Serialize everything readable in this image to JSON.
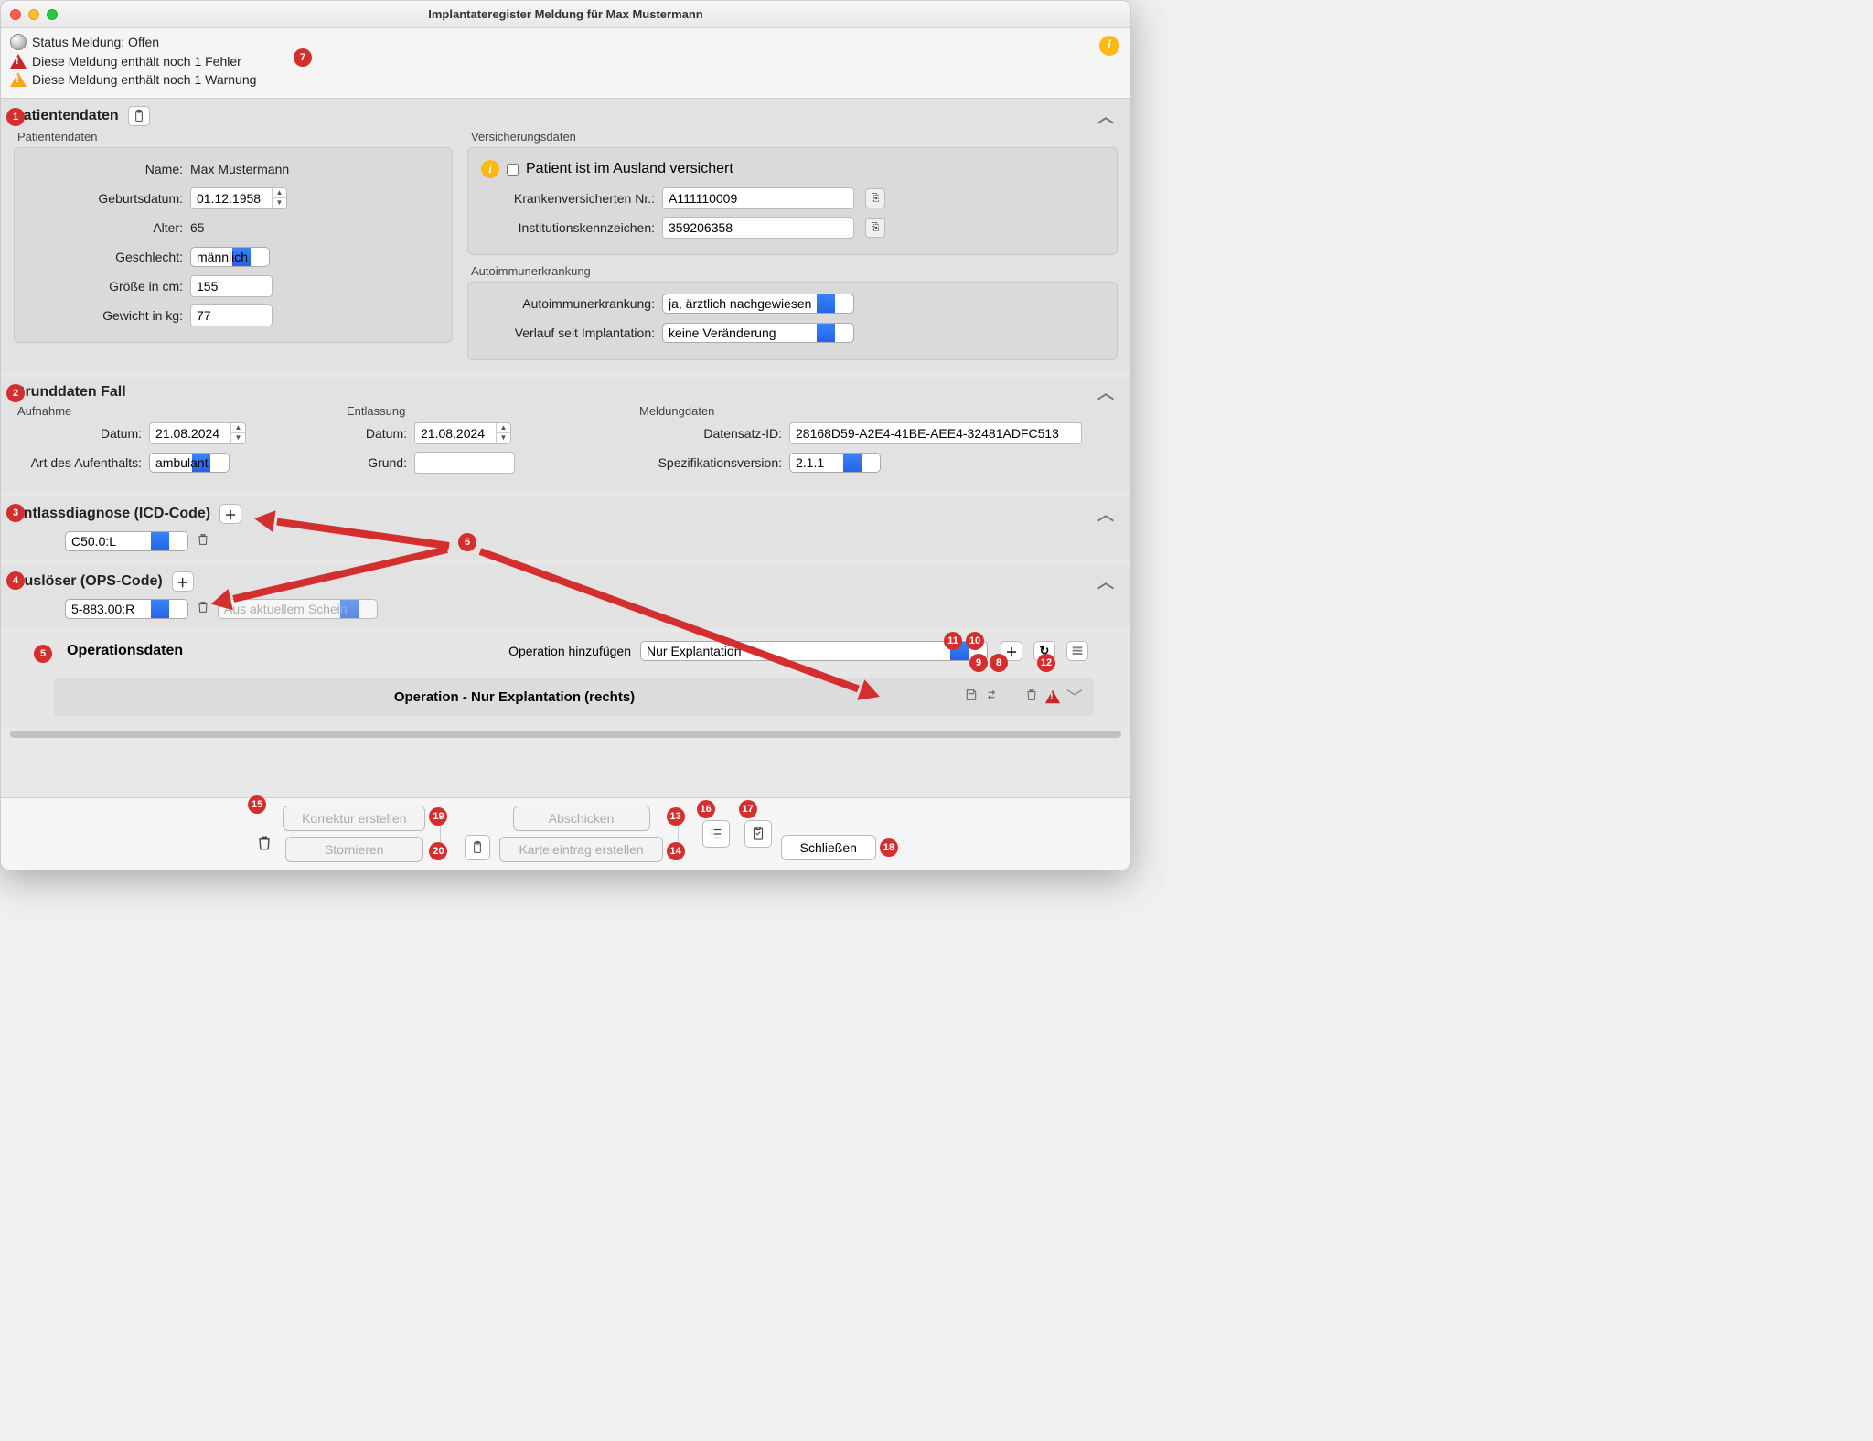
{
  "window_title": "Implantateregister Meldung für Max Mustermann",
  "status": {
    "label": "Status Meldung: Offen",
    "error": "Diese Meldung enthält noch 1 Fehler",
    "warn": "Diese Meldung enthält noch 1 Warnung"
  },
  "sec1": {
    "title": "Patientendaten",
    "left_title": "Patientendaten",
    "name_lbl": "Name:",
    "name": "Max Mustermann",
    "dob_lbl": "Geburtsdatum:",
    "dob": "01.12.1958",
    "age_lbl": "Alter:",
    "age": "65",
    "sex_lbl": "Geschlecht:",
    "sex": "männlich",
    "height_lbl": "Größe in cm:",
    "height": "155",
    "weight_lbl": "Gewicht in kg:",
    "weight": "77",
    "ins_title": "Versicherungsdaten",
    "ins_abroad_lbl": "Patient ist im Ausland versichert",
    "kv_lbl": "Krankenversicherten Nr.:",
    "kv": "A111110009",
    "ik_lbl": "Institutionskennzeichen:",
    "ik": "359206358",
    "auto_title": "Autoimmunerkrankung",
    "auto_lbl": "Autoimmunerkrankung:",
    "auto": "ja, ärztlich nachgewiesen",
    "course_lbl": "Verlauf seit Implantation:",
    "course": "keine Veränderung"
  },
  "sec2": {
    "title": "Grunddaten Fall",
    "adm_title": "Aufnahme",
    "adm_date_lbl": "Datum:",
    "adm_date": "21.08.2024",
    "stay_lbl": "Art des Aufenthalts:",
    "stay": "ambulant",
    "dis_title": "Entlassung",
    "dis_date_lbl": "Datum:",
    "dis_date": "21.08.2024",
    "reason_lbl": "Grund:",
    "reason": "",
    "rep_title": "Meldungdaten",
    "dsid_lbl": "Datensatz-ID:",
    "dsid": "28168D59-A2E4-41BE-AEE4-32481ADFC513",
    "spec_lbl": "Spezifikationsversion:",
    "spec": "2.1.1"
  },
  "sec3": {
    "title": "Entlassdiagnose (ICD-Code)",
    "code": "C50.0:L"
  },
  "sec4": {
    "title": "Auslöser (OPS-Code)",
    "code": "5-883.00:R",
    "from_schein": "Aus aktuellem Schein"
  },
  "sec5": {
    "title": "Operationsdaten",
    "add_lbl": "Operation hinzufügen",
    "add_sel": "Nur Explantation",
    "item_title": "Operation -  Nur Explantation (rechts)"
  },
  "footer": {
    "korrektur": "Korrektur erstellen",
    "storno": "Stornieren",
    "abschicken": "Abschicken",
    "kartei": "Karteieintrag erstellen",
    "close": "Schließen"
  },
  "badges": [
    "1",
    "2",
    "3",
    "4",
    "5",
    "6",
    "7",
    "8",
    "9",
    "10",
    "11",
    "12",
    "13",
    "14",
    "15",
    "16",
    "17",
    "18",
    "19",
    "20"
  ]
}
